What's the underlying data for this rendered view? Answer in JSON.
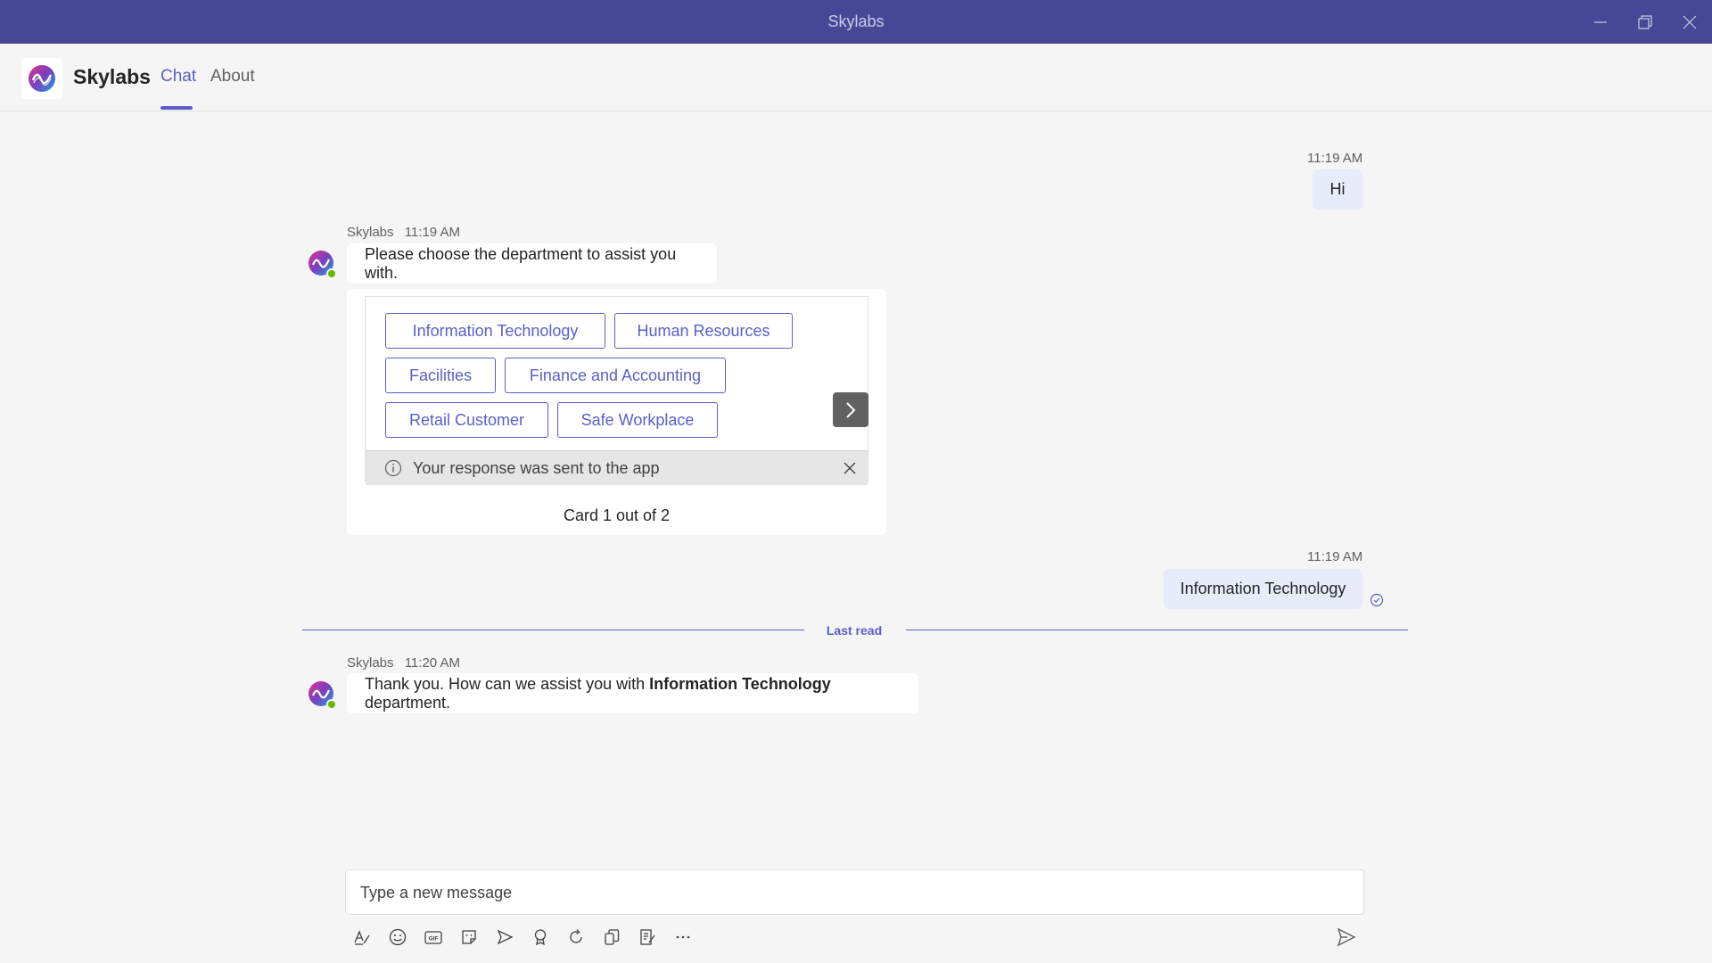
{
  "window": {
    "title": "Skylabs"
  },
  "app": {
    "name": "Skylabs",
    "tabs": [
      {
        "label": "Chat",
        "active": true
      },
      {
        "label": "About",
        "active": false
      }
    ]
  },
  "colors": {
    "titlebar": "#464896",
    "accent": "#5b5fc7",
    "my_bubble": "#e8ebfa",
    "presence": "#6bb700"
  },
  "messages": {
    "m1": {
      "time": "11:19 AM",
      "text": "Hi"
    },
    "m2": {
      "sender": "Skylabs",
      "time": "11:19 AM",
      "text": "Please choose the department to assist you with."
    },
    "card": {
      "options": [
        "Information Technology",
        "Human Resources",
        "Facilities",
        "Finance and Accounting",
        "Retail Customer",
        "Safe Workplace"
      ],
      "notice": "Your response was sent to the app",
      "counter": "Card 1 out of 2"
    },
    "m3": {
      "time": "11:19 AM",
      "text": "Information Technology"
    },
    "last_read": "Last read",
    "m4": {
      "sender": "Skylabs",
      "time": "11:20 AM",
      "text_before": "Thank you. How can we assist you with ",
      "text_bold": "Information Technology",
      "text_after": " department."
    }
  },
  "composer": {
    "placeholder": "Type a new message",
    "tools": [
      "format-icon",
      "emoji-icon",
      "gif-icon",
      "sticker-icon",
      "meet-icon",
      "praise-icon",
      "loop-icon",
      "apps-icon",
      "forms-icon",
      "more-icon"
    ]
  }
}
